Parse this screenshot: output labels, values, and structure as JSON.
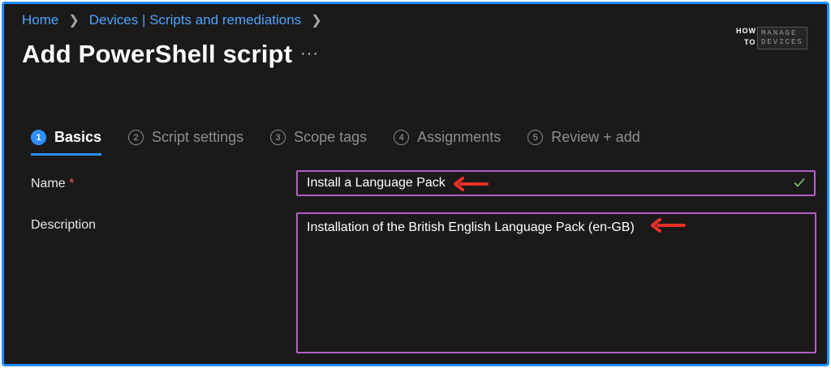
{
  "breadcrumb": {
    "items": [
      "Home",
      "Devices | Scripts and remediations"
    ]
  },
  "header": {
    "title": "Add PowerShell script",
    "more_label": "···"
  },
  "logo": {
    "how": "HOW",
    "to": "TO",
    "manage": "MANAGE",
    "devices": "DEVICES"
  },
  "steps": [
    {
      "num": "1",
      "label": "Basics",
      "active": true
    },
    {
      "num": "2",
      "label": "Script settings",
      "active": false
    },
    {
      "num": "3",
      "label": "Scope tags",
      "active": false
    },
    {
      "num": "4",
      "label": "Assignments",
      "active": false
    },
    {
      "num": "5",
      "label": "Review + add",
      "active": false
    }
  ],
  "form": {
    "name_label": "Name",
    "required_mark": "*",
    "name_value": "Install a Language Pack",
    "description_label": "Description",
    "description_value": "Installation of the British English Language Pack (en-GB)"
  },
  "colors": {
    "accent": "#2f8fff",
    "link": "#4da3ff",
    "field_border": "#b45ec8",
    "valid_check": "#8fc46a",
    "annotation_arrow": "#e8302a",
    "frame_border": "#1e90ff",
    "background": "#1b1a19"
  },
  "icons": {
    "breadcrumb_separator": "chevron-right-icon",
    "name_valid": "checkmark-icon",
    "annotation": "red-arrow-icon"
  }
}
